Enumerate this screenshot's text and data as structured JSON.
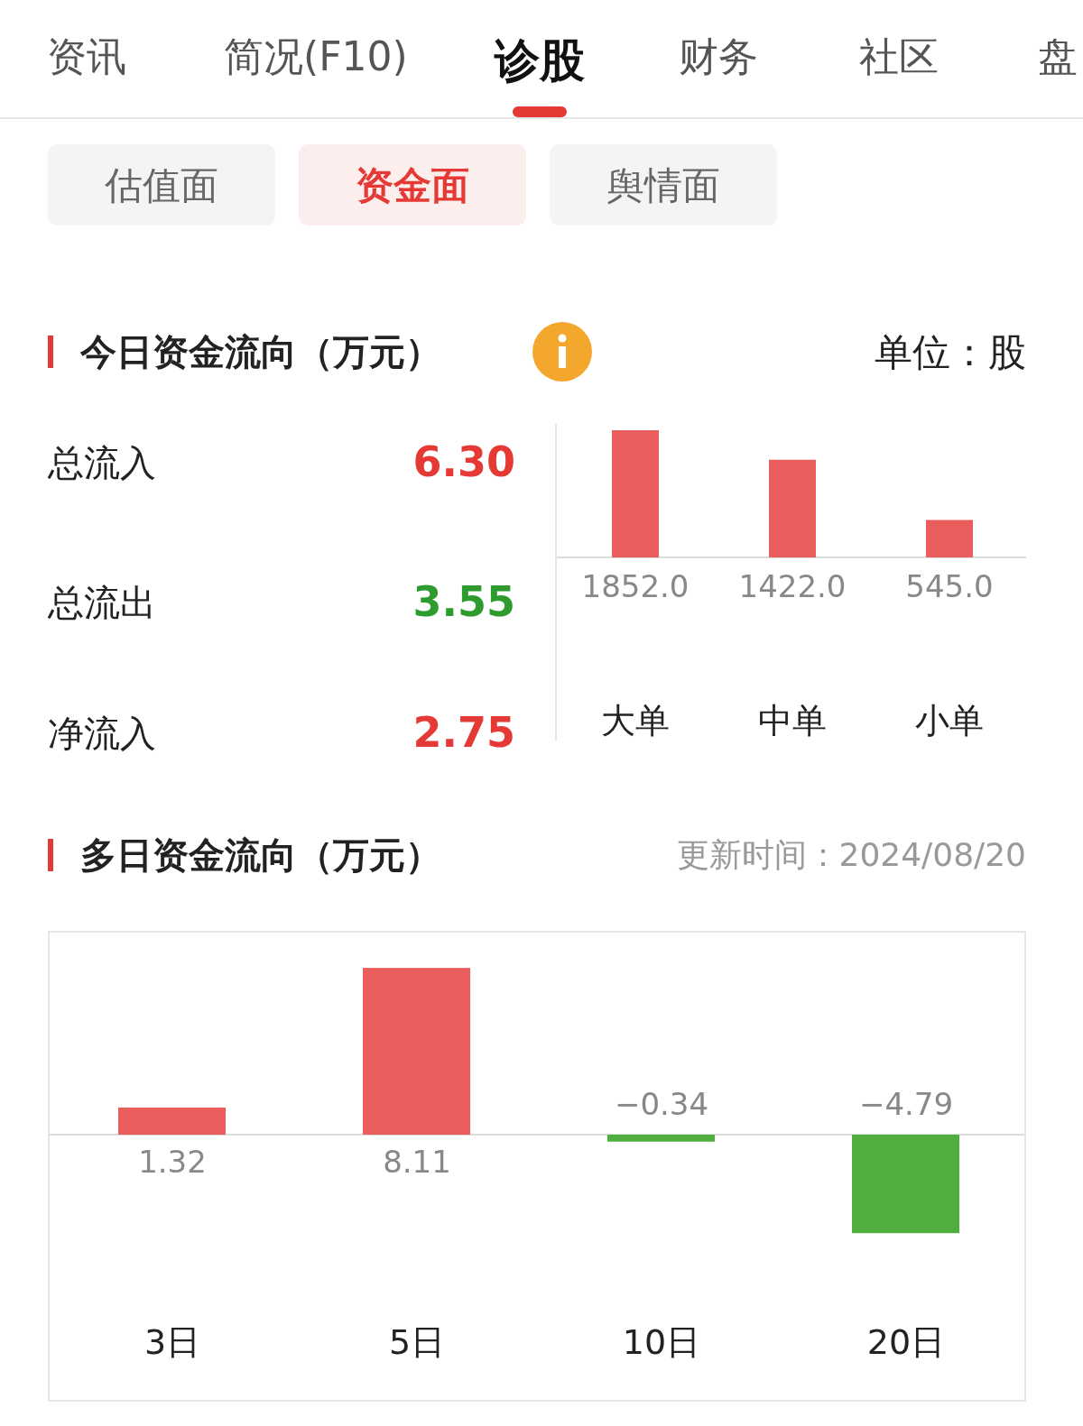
{
  "tabs": [
    {
      "label": "资讯",
      "selected": false
    },
    {
      "label": "简况(F10)",
      "selected": false
    },
    {
      "label": "诊股",
      "selected": true
    },
    {
      "label": "财务",
      "selected": false
    },
    {
      "label": "社区",
      "selected": false
    },
    {
      "label": "盘",
      "selected": false
    }
  ],
  "sub_tabs": [
    {
      "label": "估值面",
      "selected": false
    },
    {
      "label": "资金面",
      "selected": true
    },
    {
      "label": "舆情面",
      "selected": false
    }
  ],
  "today": {
    "title": "今日资金流向（万元）",
    "unit": "单位：股",
    "rows": [
      {
        "label": "总流入",
        "value": "6.30",
        "color": "#e53935"
      },
      {
        "label": "总流出",
        "value": "3.55",
        "color": "#2e9b2e"
      },
      {
        "label": "净流入",
        "value": "2.75",
        "color": "#e53935"
      }
    ],
    "chart_data": {
      "type": "bar",
      "categories": [
        "大单",
        "中单",
        "小单"
      ],
      "values": [
        1852.0,
        1422.0,
        545.0
      ],
      "data_labels": true,
      "value_labels": [
        "1852.0",
        "1422.0",
        "545.0"
      ]
    }
  },
  "multi_day": {
    "title": "多日资金流向（万元）",
    "updated": "更新时间：2024/08/20",
    "chart_data": {
      "type": "bar",
      "categories": [
        "3日",
        "5日",
        "10日",
        "20日"
      ],
      "values": [
        1.32,
        8.11,
        -0.34,
        -4.79
      ],
      "data_labels": true,
      "value_labels": [
        "1.32",
        "8.11",
        "−0.34",
        "−4.79"
      ]
    }
  }
}
